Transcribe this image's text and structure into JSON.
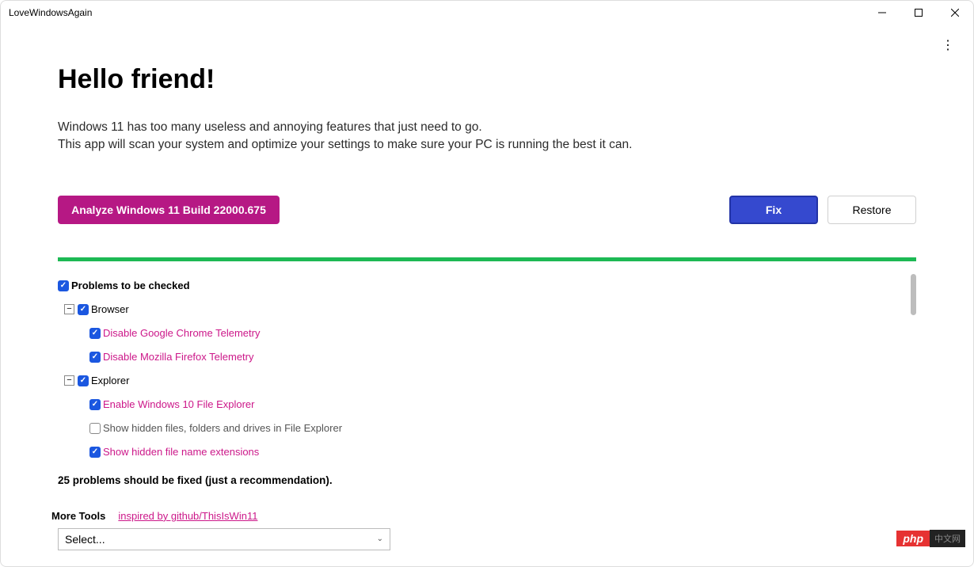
{
  "window": {
    "title": "LoveWindowsAgain"
  },
  "page": {
    "title": "Hello friend!",
    "intro_line1": "Windows 11 has too many useless and annoying features that just need to go.",
    "intro_line2": "This app will scan your system and optimize your settings to make sure your PC is running the best it can."
  },
  "buttons": {
    "analyze": "Analyze Windows 11 Build 22000.675",
    "fix": "Fix",
    "restore": "Restore"
  },
  "tree": {
    "root_label": "Problems to be checked",
    "categories": [
      {
        "name": "Browser",
        "items": [
          {
            "label": "Disable Google Chrome Telemetry",
            "checked": true,
            "problem": true
          },
          {
            "label": "Disable Mozilla Firefox Telemetry",
            "checked": true,
            "problem": true
          }
        ]
      },
      {
        "name": "Explorer",
        "items": [
          {
            "label": "Enable Windows 10 File Explorer",
            "checked": true,
            "problem": true
          },
          {
            "label": "Show hidden files, folders and drives in File Explorer",
            "checked": false,
            "problem": false
          },
          {
            "label": "Show hidden file name extensions",
            "checked": true,
            "problem": true
          }
        ]
      }
    ]
  },
  "status": "25 problems should be fixed (just a recommendation).",
  "more_tools": {
    "label": "More Tools",
    "link": "inspired by github/ThisIsWin11",
    "select": "Select..."
  },
  "watermark": {
    "php": "php",
    "cn": "中文网"
  }
}
